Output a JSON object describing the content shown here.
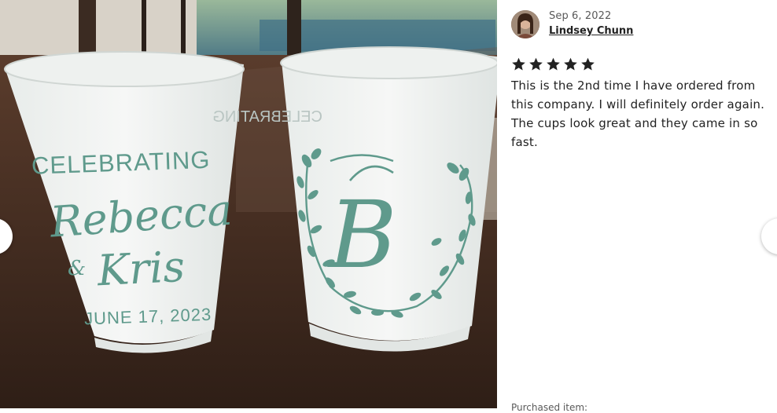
{
  "review": {
    "date": "Sep 6, 2022",
    "author": "Lindsey Chunn",
    "rating": 5,
    "text": "This is the 2nd time I have ordered from this company. I will definitely order again. The cups look great and they came in so fast.",
    "footer": "Purchased item:"
  },
  "photo": {
    "cup_left": {
      "line1": "CELEBRATING",
      "name1": "Rebecca",
      "amp": "&",
      "name2": "Kris",
      "date": "JUNE 17, 2023"
    },
    "cup_right": {
      "monogram": "B",
      "mirror_text": "CELEBRATING"
    }
  },
  "colors": {
    "print": "#5f9a8c",
    "star": "#222222"
  },
  "icons": {
    "prev": "chevron-left-icon",
    "next": "chevron-right-icon",
    "star": "star-icon"
  }
}
